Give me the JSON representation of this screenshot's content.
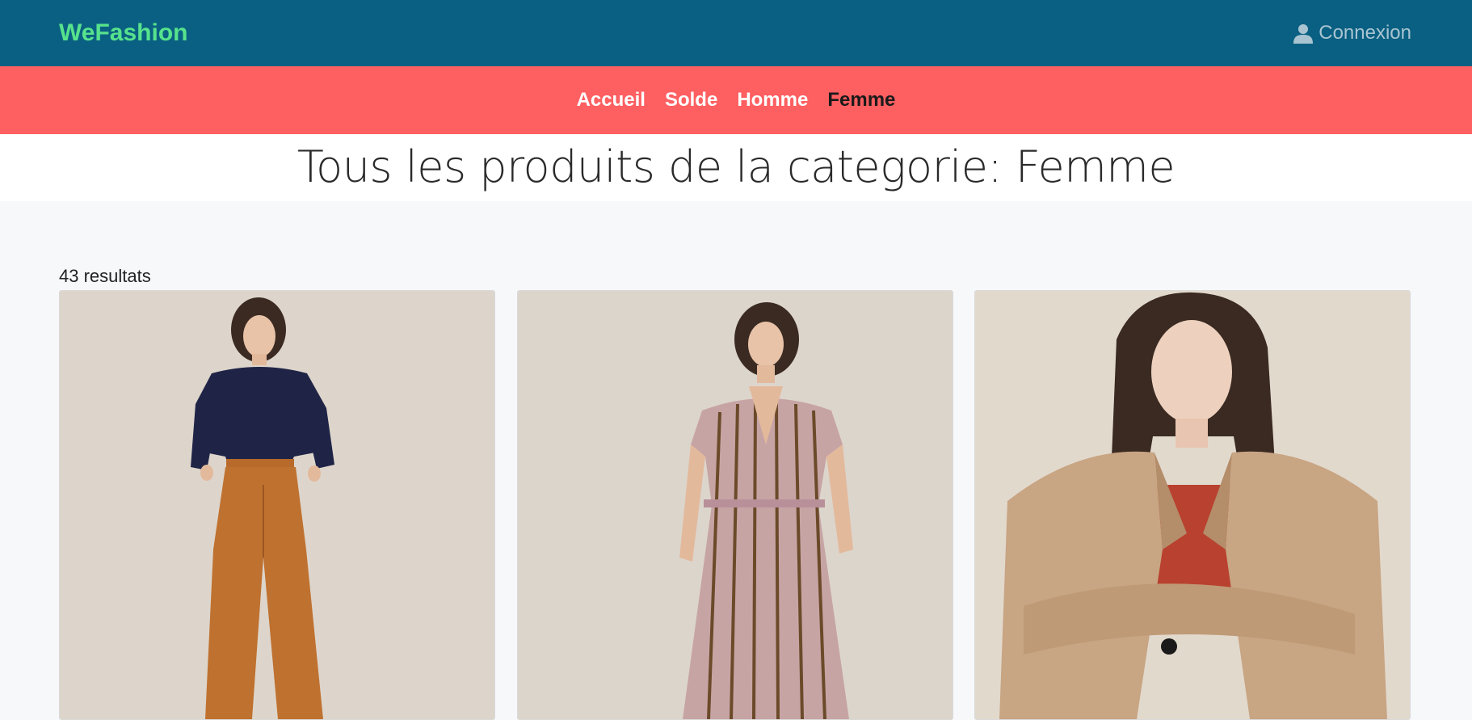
{
  "header": {
    "brand": "WeFashion",
    "login_label": "Connexion",
    "login_icon": "user-icon"
  },
  "category_nav": {
    "items": [
      {
        "label": "Accueil",
        "active": false
      },
      {
        "label": "Solde",
        "active": false
      },
      {
        "label": "Homme",
        "active": false
      },
      {
        "label": "Femme",
        "active": true
      }
    ]
  },
  "page": {
    "title": "Tous les produits de la categorie: Femme",
    "result_count": "43 resultats"
  },
  "products": [
    {
      "image": "product-image-navy-sweater-rust-trousers"
    },
    {
      "image": "product-image-striped-pink-dress"
    },
    {
      "image": "product-image-beige-trench-coat"
    }
  ],
  "colors": {
    "topbar": "#0a6082",
    "brand": "#57e28c",
    "category_bar": "#fe5f61",
    "active_category": "#1a1a1a",
    "background": "#f7f8fa"
  }
}
